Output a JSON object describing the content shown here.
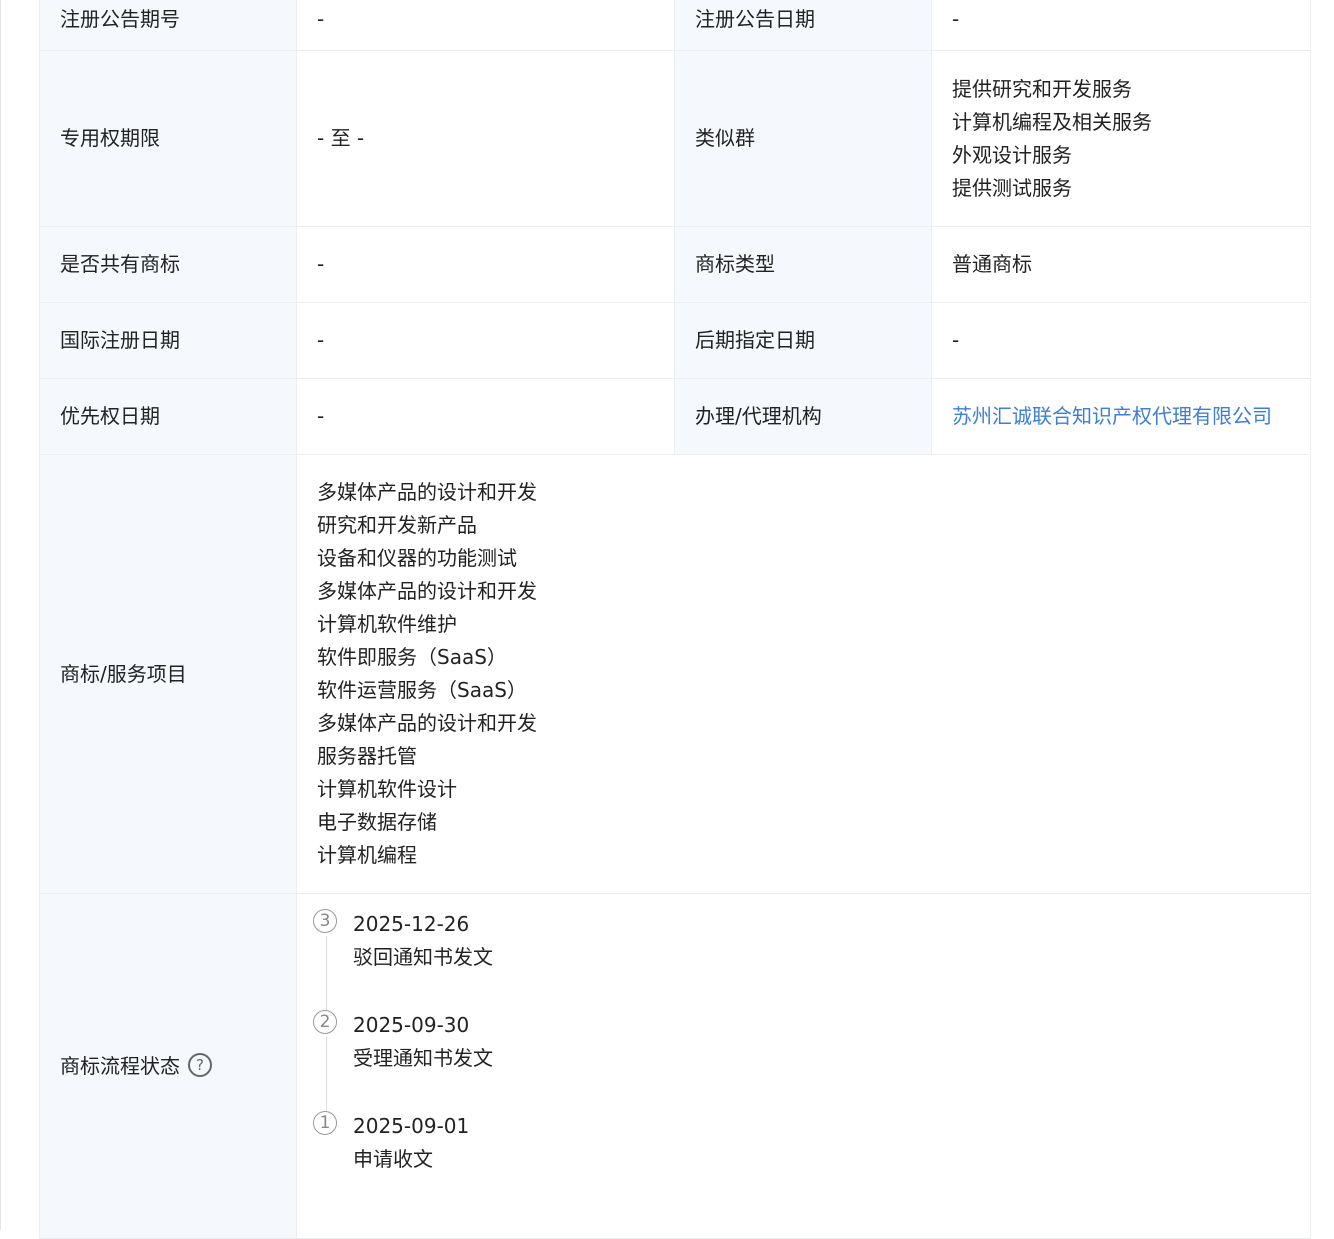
{
  "rows": {
    "reg_announce_no": {
      "label": "注册公告期号",
      "value": "-"
    },
    "reg_announce_date": {
      "label": "注册公告日期",
      "value": "-"
    },
    "exclusive_period": {
      "label": "专用权期限",
      "value": "- 至 -"
    },
    "similar_group": {
      "label": "类似群",
      "values": [
        "提供研究和开发服务",
        "计算机编程及相关服务",
        "外观设计服务",
        "提供测试服务"
      ]
    },
    "shared_mark": {
      "label": "是否共有商标",
      "value": "-"
    },
    "mark_type": {
      "label": "商标类型",
      "value": "普通商标"
    },
    "intl_reg_date": {
      "label": "国际注册日期",
      "value": "-"
    },
    "later_designation_date": {
      "label": "后期指定日期",
      "value": "-"
    },
    "priority_date": {
      "label": "优先权日期",
      "value": "-"
    },
    "agency": {
      "label": "办理/代理机构",
      "value": "苏州汇诚联合知识产权代理有限公司"
    },
    "services": {
      "label": "商标/服务项目",
      "items": [
        "多媒体产品的设计和开发",
        "研究和开发新产品",
        "设备和仪器的功能测试",
        "多媒体产品的设计和开发",
        "计算机软件维护",
        "软件即服务（SaaS）",
        "软件运营服务（SaaS）",
        "多媒体产品的设计和开发",
        "服务器托管",
        "计算机软件设计",
        "电子数据存储",
        "计算机编程"
      ]
    },
    "process": {
      "label": "商标流程状态",
      "help_icon": "?",
      "steps": [
        {
          "num": "3",
          "date": "2025-12-26",
          "text": "驳回通知书发文"
        },
        {
          "num": "2",
          "date": "2025-09-30",
          "text": "受理通知书发文"
        },
        {
          "num": "1",
          "date": "2025-09-01",
          "text": "申请收文"
        }
      ]
    }
  },
  "colors": {
    "label_bg": "#f5f8fd",
    "border": "#eceef2",
    "link": "#3d7fd4"
  }
}
